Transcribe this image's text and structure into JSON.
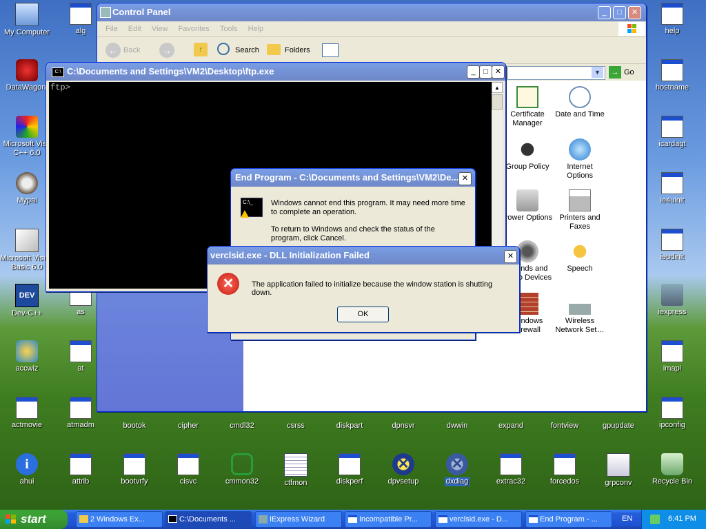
{
  "desktop": {
    "left_icons": [
      {
        "label": "My Computer",
        "icon": "my-computer-icon"
      },
      {
        "label": "DataWagon.",
        "icon": "datawagon-icon"
      },
      {
        "label": "Microsoft Visu C++ 6.0",
        "icon": "vcpp-icon"
      },
      {
        "label": "Mypal",
        "icon": "mypal-icon"
      },
      {
        "label": "Microsoft Visual Basic 6.0",
        "icon": "vb6-icon"
      },
      {
        "label": "Dev-C++",
        "icon": "devcpp-icon"
      },
      {
        "label": "accwiz",
        "icon": "accwiz-icon"
      },
      {
        "label": "actmovie",
        "icon": "app-window-icon"
      },
      {
        "label": "ahui",
        "icon": "info-icon"
      }
    ],
    "col2_icons": [
      {
        "label": "alg"
      },
      {
        "label": "as"
      },
      {
        "label": "at"
      },
      {
        "label": "atmadm"
      },
      {
        "label": "attrib"
      }
    ],
    "right_icons": [
      {
        "label": "help"
      },
      {
        "label": "hostname"
      },
      {
        "label": "icardagt"
      },
      {
        "label": "ie4uinit"
      },
      {
        "label": "ieudinit"
      },
      {
        "label": "iexpress"
      },
      {
        "label": "imapi"
      },
      {
        "label": "ipconfig"
      },
      {
        "label": "Recycle Bin"
      }
    ],
    "row1_icons": [
      {
        "label": "bootok"
      },
      {
        "label": "cipher"
      },
      {
        "label": "cmdl32"
      },
      {
        "label": "csrss"
      },
      {
        "label": "diskpart"
      },
      {
        "label": "dpnsvr"
      },
      {
        "label": "dwwin"
      },
      {
        "label": "expand"
      },
      {
        "label": "fontview"
      },
      {
        "label": "gpupdate"
      }
    ],
    "row2_icons": [
      {
        "label": "bootvrfy"
      },
      {
        "label": "cisvc"
      },
      {
        "label": "cmmon32"
      },
      {
        "label": "ctfmon"
      },
      {
        "label": "diskperf"
      },
      {
        "label": "dpvsetup"
      },
      {
        "label": "dxdiag"
      },
      {
        "label": "extrac32"
      },
      {
        "label": "forcedos"
      },
      {
        "label": "grpconv"
      }
    ]
  },
  "control_panel": {
    "title": "Control Panel",
    "menu": [
      "File",
      "Edit",
      "View",
      "Favorites",
      "Tools",
      "Help"
    ],
    "toolbar": {
      "back": "Back",
      "search": "Search",
      "folders": "Folders"
    },
    "go": "Go",
    "items": [
      {
        "label": "Certificate Manager",
        "icon": "certificate-icon"
      },
      {
        "label": "Date and Time",
        "icon": "clock-icon"
      },
      {
        "label": "Group Policy",
        "icon": "group-policy-icon"
      },
      {
        "label": "Internet Options",
        "icon": "globe-icon"
      },
      {
        "label": "Power Options",
        "icon": "power-icon"
      },
      {
        "label": "Printers and Faxes",
        "icon": "printer-icon"
      },
      {
        "label": "Sounds and Audio Devices",
        "icon": "speaker-icon"
      },
      {
        "label": "Speech",
        "icon": "speech-icon"
      },
      {
        "label": "Windows Firewall",
        "icon": "firewall-icon"
      },
      {
        "label": "Wireless Network Set…",
        "icon": "wireless-icon"
      }
    ]
  },
  "ftp": {
    "title": "C:\\Documents and Settings\\VM2\\Desktop\\ftp.exe",
    "prompt": "ftp>"
  },
  "end_program": {
    "title": "End Program - C:\\Documents and Settings\\VM2\\De...",
    "msg1": "Windows cannot end this program. It may need more time to complete an operation.",
    "msg2": "To return to Windows and check the status of the program, click Cancel."
  },
  "dll_error": {
    "title": "verclsid.exe - DLL Initialization Failed",
    "message": "The application failed to initialize because the window station is shutting down.",
    "ok": "OK"
  },
  "taskbar": {
    "start": "start",
    "items": [
      {
        "label": "2 Windows Ex...",
        "icon": "folder-icon"
      },
      {
        "label": "C:\\Documents ...",
        "icon": "console-icon"
      },
      {
        "label": "IExpress Wizard",
        "icon": "iexpress-icon"
      },
      {
        "label": "Incompatible Pr...",
        "icon": "window-icon"
      },
      {
        "label": "verclsid.exe - D...",
        "icon": "window-icon"
      },
      {
        "label": "End Program - ...",
        "icon": "window-icon"
      }
    ],
    "lang": "EN",
    "time": "6:41 PM"
  },
  "colors": {
    "title_active": "#0054e3",
    "close_red": "#d9432b",
    "desktop_sky": "#6a9be0",
    "desktop_grass": "#3f7d21"
  }
}
